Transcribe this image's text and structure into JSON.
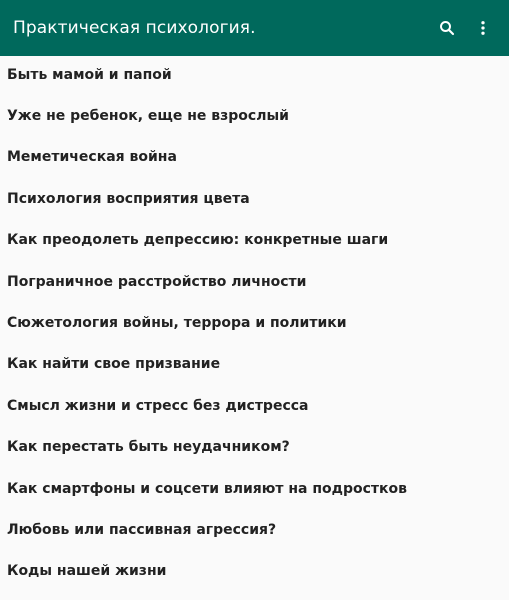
{
  "toolbar": {
    "title": "Практическая психология.",
    "background": "#00695c",
    "actions": [
      {
        "icon": "search-icon"
      },
      {
        "icon": "more-vert-icon"
      }
    ]
  },
  "list": {
    "items": [
      {
        "label": "Быть мамой и папой"
      },
      {
        "label": "Уже не ребенок, еще не взрослый"
      },
      {
        "label": "Меметическая война"
      },
      {
        "label": "Психология восприятия цвета"
      },
      {
        "label": "Как преодолеть депрессию: конкретные шаги"
      },
      {
        "label": "Пограничное расстройство личности"
      },
      {
        "label": "Сюжетология войны, террора и политики"
      },
      {
        "label": "Как найти свое призвание"
      },
      {
        "label": "Смысл жизни и стресс без дистресса"
      },
      {
        "label": "Как перестать быть неудачником?"
      },
      {
        "label": "Как смартфоны и соцсети влияют на подростков"
      },
      {
        "label": "Любовь или пассивная агрессия?"
      },
      {
        "label": "Коды нашей жизни"
      }
    ]
  }
}
